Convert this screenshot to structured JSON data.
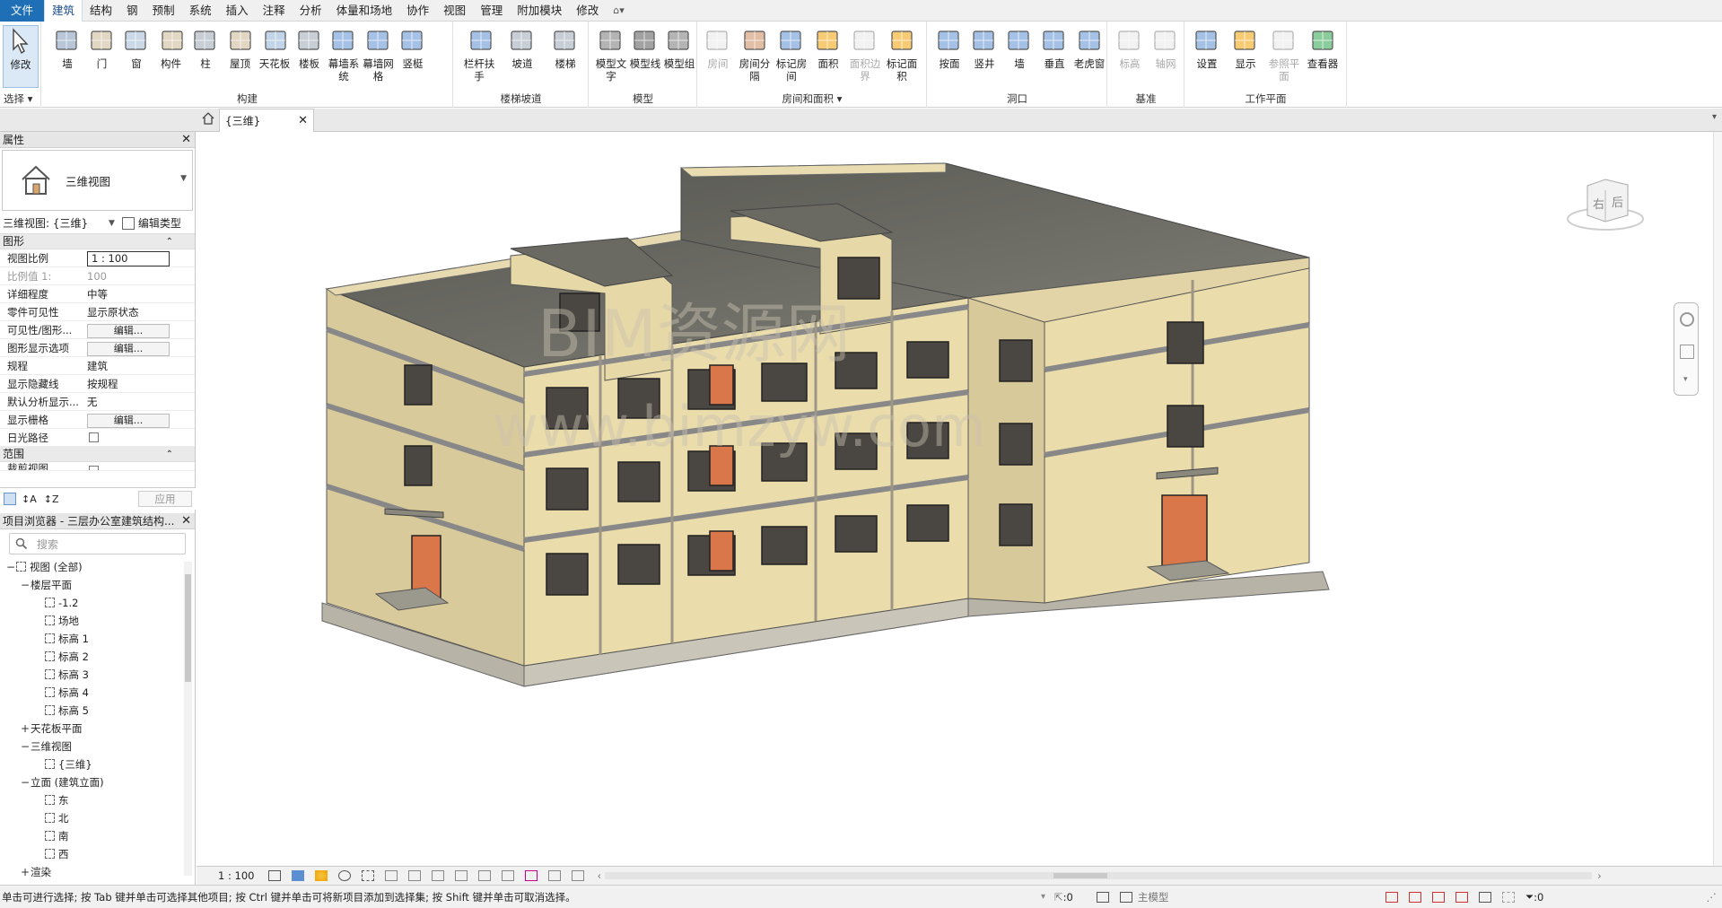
{
  "menubar": {
    "items": [
      "文件",
      "建筑",
      "结构",
      "钢",
      "预制",
      "系统",
      "插入",
      "注释",
      "分析",
      "体量和场地",
      "协作",
      "视图",
      "管理",
      "附加模块",
      "修改"
    ],
    "active": "建筑"
  },
  "ribbon": {
    "select": {
      "modify": "修改",
      "title": "选择"
    },
    "build": {
      "title": "构建",
      "buttons": [
        "墙",
        "门",
        "窗",
        "构件",
        "柱",
        "屋顶",
        "天花板",
        "楼板",
        "幕墙系统",
        "幕墙网格",
        "竖梃"
      ]
    },
    "stairs": {
      "title": "楼梯坡道",
      "buttons": [
        "栏杆扶手",
        "坡道",
        "楼梯"
      ]
    },
    "model": {
      "title": "模型",
      "buttons": [
        "模型文字",
        "模型线",
        "模型组"
      ]
    },
    "room": {
      "title": "房间和面积",
      "buttons": [
        "房间",
        "房间分隔",
        "标记房间",
        "面积",
        "面积边界",
        "标记面积"
      ]
    },
    "opening": {
      "title": "洞口",
      "buttons": [
        "按面",
        "竖井",
        "墙",
        "垂直",
        "老虎窗"
      ]
    },
    "datum": {
      "title": "基准",
      "buttons": [
        "标高",
        "轴网"
      ]
    },
    "workplane": {
      "title": "工作平面",
      "buttons": [
        "设置",
        "显示",
        "参照平面",
        "查看器"
      ]
    }
  },
  "view_tab": {
    "label": "{三维}"
  },
  "properties": {
    "header": "属性",
    "type_name": "三维视图",
    "instance": "三维视图: {三维}",
    "edit_type": "编辑类型",
    "section_graphics": "图形",
    "rows": [
      {
        "k": "视图比例",
        "v": "1 : 100"
      },
      {
        "k": "比例值 1:",
        "v": "100"
      },
      {
        "k": "详细程度",
        "v": "中等"
      },
      {
        "k": "零件可见性",
        "v": "显示原状态"
      },
      {
        "k": "可见性/图形...",
        "v": "编辑..."
      },
      {
        "k": "图形显示选项",
        "v": "编辑..."
      },
      {
        "k": "规程",
        "v": "建筑"
      },
      {
        "k": "显示隐藏线",
        "v": "按规程"
      },
      {
        "k": "默认分析显示...",
        "v": "无"
      },
      {
        "k": "显示栅格",
        "v": "编辑..."
      },
      {
        "k": "日光路径",
        "v": ""
      }
    ],
    "section_extent": "范围",
    "crop_row": "裁剪视图",
    "apply": "应用"
  },
  "browser": {
    "header": "项目浏览器 - 三层办公室建筑结构...",
    "search_placeholder": "搜索",
    "tree": [
      {
        "level": 0,
        "exp": "−",
        "icon": true,
        "label": "视图 (全部)"
      },
      {
        "level": 1,
        "exp": "−",
        "icon": false,
        "label": "楼层平面"
      },
      {
        "level": 2,
        "exp": "",
        "icon": true,
        "label": "-1.2"
      },
      {
        "level": 2,
        "exp": "",
        "icon": true,
        "label": "场地"
      },
      {
        "level": 2,
        "exp": "",
        "icon": true,
        "label": "标高 1"
      },
      {
        "level": 2,
        "exp": "",
        "icon": true,
        "label": "标高 2"
      },
      {
        "level": 2,
        "exp": "",
        "icon": true,
        "label": "标高 3"
      },
      {
        "level": 2,
        "exp": "",
        "icon": true,
        "label": "标高 4"
      },
      {
        "level": 2,
        "exp": "",
        "icon": true,
        "label": "标高 5"
      },
      {
        "level": 1,
        "exp": "+",
        "icon": false,
        "label": "天花板平面"
      },
      {
        "level": 1,
        "exp": "−",
        "icon": false,
        "label": "三维视图"
      },
      {
        "level": 2,
        "exp": "",
        "icon": true,
        "label": "{三维}"
      },
      {
        "level": 1,
        "exp": "−",
        "icon": false,
        "label": "立面 (建筑立面)"
      },
      {
        "level": 2,
        "exp": "",
        "icon": true,
        "label": "东"
      },
      {
        "level": 2,
        "exp": "",
        "icon": true,
        "label": "北"
      },
      {
        "level": 2,
        "exp": "",
        "icon": true,
        "label": "南"
      },
      {
        "level": 2,
        "exp": "",
        "icon": true,
        "label": "西"
      },
      {
        "level": 1,
        "exp": "+",
        "icon": false,
        "label": "渲染"
      }
    ]
  },
  "viewcube": {
    "right": "右",
    "back": "后"
  },
  "watermark": {
    "line1": "BIM资源网",
    "line2": "www.bimzyw.com"
  },
  "viewbar": {
    "scale": "1 : 100"
  },
  "status": {
    "hint": "单击可进行选择; 按 Tab 键并单击可选择其他项目; 按 Ctrl 键并单击可将新项目添加到选择集; 按 Shift 键并单击可取消选择。",
    "sel_count": ":0",
    "model": "主模型",
    "filter_count": ":0"
  }
}
